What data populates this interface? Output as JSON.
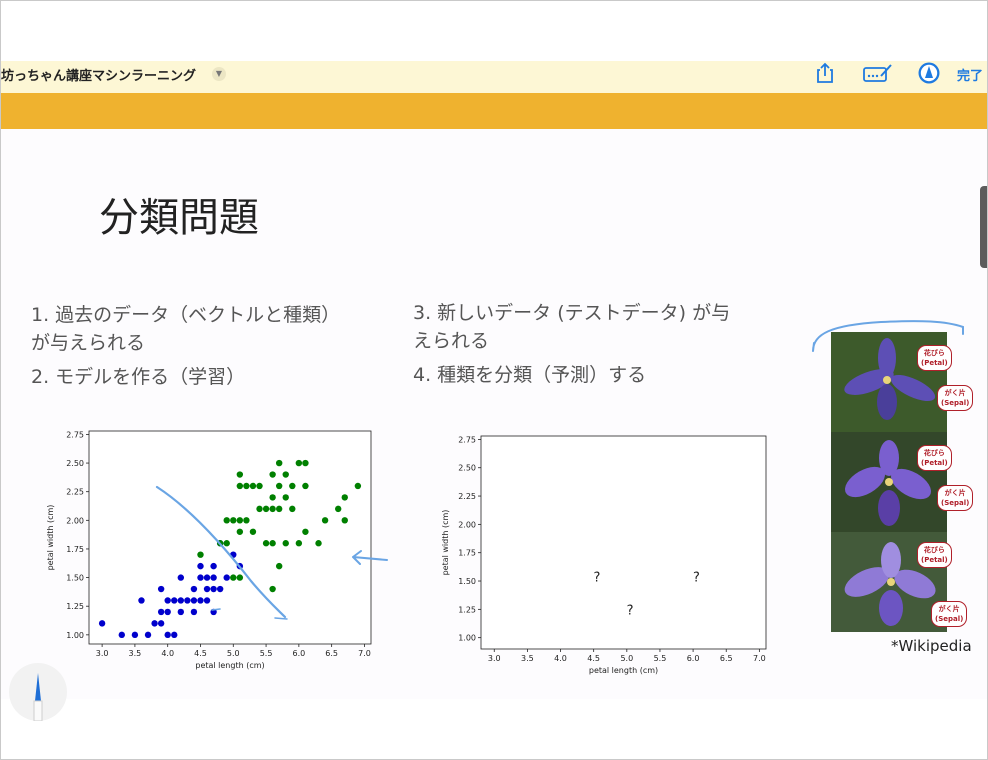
{
  "app": {
    "title": "坊っちゃん講座マシンラーニング",
    "done_label": "完了",
    "icons": [
      "share-icon",
      "markup-icon",
      "pencil-circle-icon",
      "chevron-down-icon"
    ]
  },
  "slide": {
    "heading": "分類問題",
    "left_bullets": [
      "1. 過去のデータ（ベクトルと種類）",
      "が与えられる",
      "2. モデルを作る（学習）"
    ],
    "right_bullets": [
      "3. 新しいデータ (テストデータ) が与",
      "えられる",
      "4. 種類を分類（予測）する"
    ],
    "credit": "*Wikipedia",
    "flower_callouts": [
      {
        "line1": "花びら",
        "line2": "(Petal)"
      },
      {
        "line1": "がく片",
        "line2": "(Sepal)"
      },
      {
        "line1": "花びら",
        "line2": "(Petal)"
      },
      {
        "line1": "がく片",
        "line2": "(Sepal)"
      },
      {
        "line1": "花びら",
        "line2": "(Petal)"
      },
      {
        "line1": "がく片",
        "line2": "(Sepal)"
      }
    ]
  },
  "colors": {
    "accent_bar": "#efb22f",
    "toolbar_bg": "#fdf7d5",
    "link_blue": "#1e7ae0",
    "ink": "#6aa5e4",
    "class_blue": "#0000cc",
    "class_green": "#008000"
  },
  "chart_data": [
    {
      "type": "scatter",
      "xlabel": "petal length (cm)",
      "ylabel": "petal width (cm)",
      "xlim": [
        2.8,
        7.1
      ],
      "ylim": [
        0.92,
        2.78
      ],
      "xticks": [
        "3.0",
        "3.5",
        "4.0",
        "4.5",
        "5.0",
        "5.5",
        "6.0",
        "6.5",
        "7.0"
      ],
      "yticks": [
        "1.00",
        "1.25",
        "1.50",
        "1.75",
        "2.00",
        "2.25",
        "2.50",
        "2.75"
      ],
      "series": [
        {
          "color": "#0000cc",
          "points": [
            [
              3.0,
              1.1
            ],
            [
              3.3,
              1.0
            ],
            [
              3.5,
              1.0
            ],
            [
              3.6,
              1.3
            ],
            [
              3.7,
              1.0
            ],
            [
              3.8,
              1.1
            ],
            [
              3.9,
              1.1
            ],
            [
              3.9,
              1.2
            ],
            [
              3.9,
              1.4
            ],
            [
              4.0,
              1.0
            ],
            [
              4.0,
              1.2
            ],
            [
              4.0,
              1.3
            ],
            [
              4.1,
              1.0
            ],
            [
              4.1,
              1.3
            ],
            [
              4.2,
              1.2
            ],
            [
              4.2,
              1.3
            ],
            [
              4.2,
              1.5
            ],
            [
              4.3,
              1.3
            ],
            [
              4.4,
              1.2
            ],
            [
              4.4,
              1.3
            ],
            [
              4.4,
              1.4
            ],
            [
              4.5,
              1.3
            ],
            [
              4.5,
              1.5
            ],
            [
              4.5,
              1.6
            ],
            [
              4.6,
              1.3
            ],
            [
              4.6,
              1.4
            ],
            [
              4.6,
              1.5
            ],
            [
              4.7,
              1.2
            ],
            [
              4.7,
              1.4
            ],
            [
              4.7,
              1.5
            ],
            [
              4.7,
              1.6
            ],
            [
              4.8,
              1.4
            ],
            [
              4.8,
              1.8
            ],
            [
              4.9,
              1.5
            ],
            [
              5.0,
              1.7
            ],
            [
              5.1,
              1.6
            ]
          ]
        },
        {
          "color": "#008000",
          "points": [
            [
              4.5,
              1.7
            ],
            [
              4.8,
              1.8
            ],
            [
              4.9,
              1.8
            ],
            [
              4.9,
              2.0
            ],
            [
              5.0,
              1.5
            ],
            [
              5.0,
              2.0
            ],
            [
              5.1,
              1.5
            ],
            [
              5.1,
              1.9
            ],
            [
              5.1,
              2.0
            ],
            [
              5.1,
              2.3
            ],
            [
              5.1,
              2.4
            ],
            [
              5.2,
              2.0
            ],
            [
              5.2,
              2.3
            ],
            [
              5.3,
              1.9
            ],
            [
              5.3,
              2.3
            ],
            [
              5.4,
              2.1
            ],
            [
              5.4,
              2.3
            ],
            [
              5.5,
              1.8
            ],
            [
              5.5,
              2.1
            ],
            [
              5.6,
              1.4
            ],
            [
              5.6,
              1.8
            ],
            [
              5.6,
              2.1
            ],
            [
              5.6,
              2.2
            ],
            [
              5.6,
              2.4
            ],
            [
              5.7,
              2.1
            ],
            [
              5.7,
              2.3
            ],
            [
              5.7,
              2.5
            ],
            [
              5.8,
              1.8
            ],
            [
              5.8,
              2.2
            ],
            [
              5.8,
              2.4
            ],
            [
              5.9,
              2.1
            ],
            [
              5.9,
              2.3
            ],
            [
              6.0,
              1.8
            ],
            [
              6.0,
              2.5
            ],
            [
              6.1,
              1.9
            ],
            [
              6.1,
              2.3
            ],
            [
              6.1,
              2.5
            ],
            [
              6.3,
              1.8
            ],
            [
              6.4,
              2.0
            ],
            [
              6.6,
              2.1
            ],
            [
              6.7,
              2.2
            ],
            [
              6.7,
              2.0
            ],
            [
              6.9,
              2.3
            ],
            [
              5.7,
              1.6
            ]
          ]
        }
      ]
    },
    {
      "type": "scatter",
      "xlabel": "petal length (cm)",
      "ylabel": "petal width (cm)",
      "xlim": [
        2.8,
        7.1
      ],
      "ylim": [
        0.9,
        2.78
      ],
      "xticks": [
        "3.0",
        "3.5",
        "4.0",
        "4.5",
        "5.0",
        "5.5",
        "6.0",
        "6.5",
        "7.0"
      ],
      "yticks": [
        "1.00",
        "1.25",
        "1.50",
        "1.75",
        "2.00",
        "2.25",
        "2.50",
        "2.75"
      ],
      "markers": [
        {
          "label": "?",
          "x": 4.55,
          "y": 1.53
        },
        {
          "label": "?",
          "x": 5.05,
          "y": 1.24
        },
        {
          "label": "?",
          "x": 6.05,
          "y": 1.53
        }
      ]
    }
  ]
}
